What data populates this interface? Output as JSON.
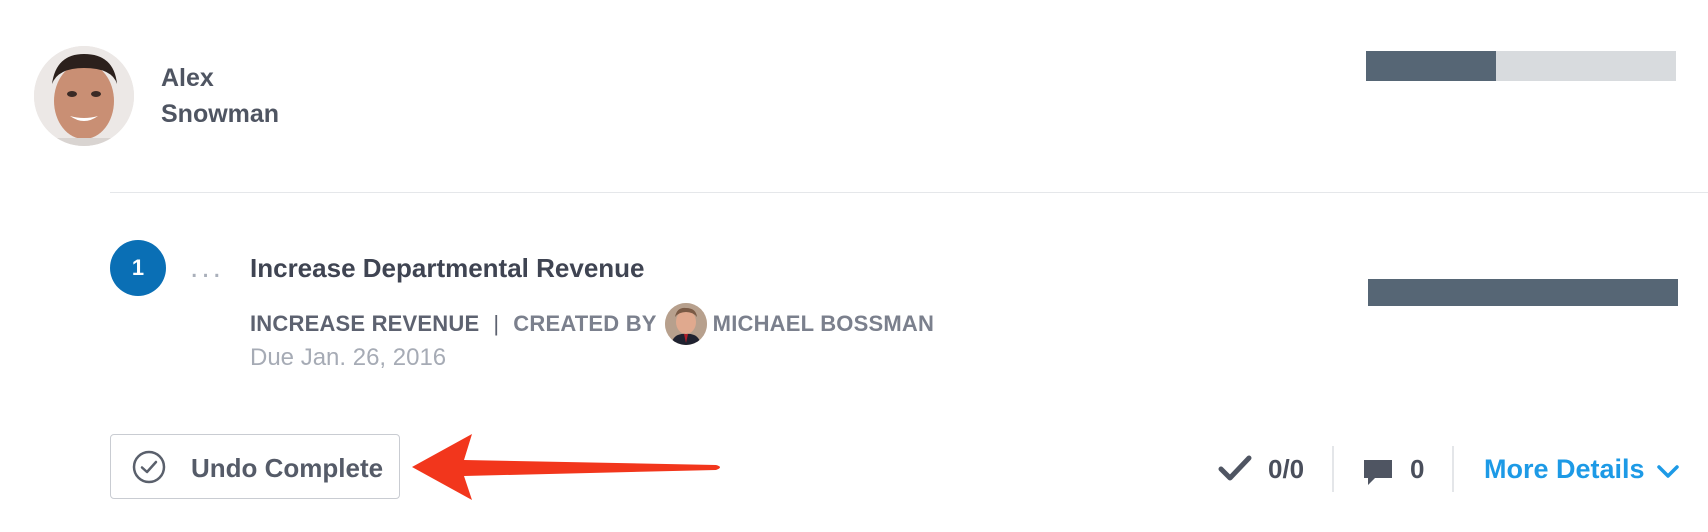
{
  "user": {
    "first_name": "Alex",
    "last_name": "Snowman",
    "progress": 0.42
  },
  "goal": {
    "number": "1",
    "more_menu": "...",
    "title": "Increase Departmental Revenue",
    "category": "INCREASE REVENUE",
    "separator": "|",
    "created_by_label": "CREATED BY",
    "creator_name": "MICHAEL BOSSMAN",
    "due": "Due Jan. 26, 2016",
    "progress": 1.0
  },
  "actions": {
    "undo_label": "Undo Complete",
    "undo_icon": "check-circle-icon",
    "tasks": "0/0",
    "tasks_icon": "checkmark-icon",
    "comments": "0",
    "comments_icon": "comment-icon",
    "more_details_label": "More Details",
    "more_details_icon": "chevron-down-icon"
  },
  "colors": {
    "progress_fill": "#566675",
    "progress_track": "#d8dbde",
    "badge": "#0a6fb5",
    "link": "#1d9ae6",
    "annotation_arrow": "#f2361c"
  }
}
